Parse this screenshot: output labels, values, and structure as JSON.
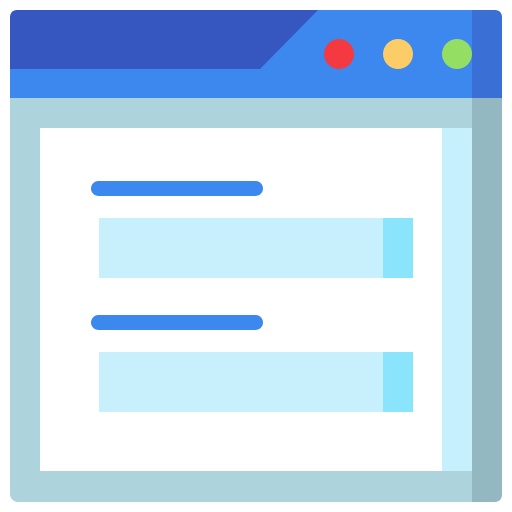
{
  "colors": {
    "titlebar_dark": "#3656C0",
    "titlebar_light": "#3C88EE",
    "titlebar_edge": "#3A70D6",
    "frame": "#ADD3DD",
    "frame_shade": "#94B8C2",
    "content": "#FFFFFF",
    "content_edge": "#C6F0FC",
    "label_bar": "#3C88EE",
    "field": "#C8F0FC",
    "field_accent": "#8AE4FC",
    "dot_close": "#F43A40",
    "dot_minimize": "#FCCD66",
    "dot_maximize": "#94DE63"
  },
  "window": {
    "buttons": [
      {
        "icon": "close-dot-icon",
        "color": "#F43A40"
      },
      {
        "icon": "minimize-dot-icon",
        "color": "#FCCD66"
      },
      {
        "icon": "maximize-dot-icon",
        "color": "#94DE63"
      }
    ]
  },
  "form": {
    "fields": [
      {
        "icon": "label-bar-icon",
        "input": "text-field-icon"
      },
      {
        "icon": "label-bar-icon",
        "input": "text-field-icon"
      }
    ]
  }
}
